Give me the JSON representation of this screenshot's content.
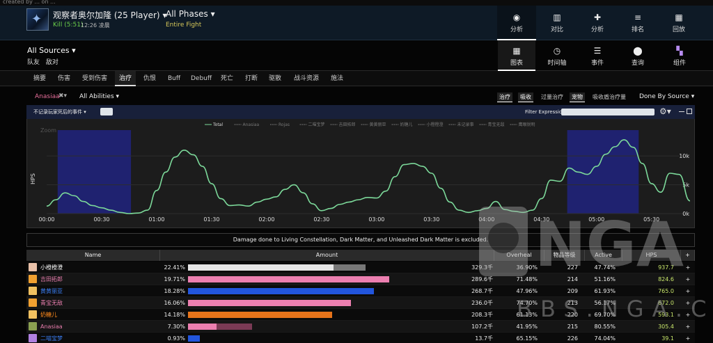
{
  "topstrip": {
    "text": "created by ... on ..."
  },
  "fight": {
    "boss_name": "观察者奥尔加隆 (25 Player)",
    "kill": "Kill (5:51)",
    "kill_time": "12:26 凌晨",
    "phases": "All Phases",
    "entire": "Entire Fight"
  },
  "topnav": [
    {
      "label": "分析",
      "icon": "eye-icon",
      "glyph": "◉"
    },
    {
      "label": "对比",
      "icon": "compare-icon",
      "glyph": "▥"
    },
    {
      "label": "分析",
      "icon": "puzzle-icon",
      "glyph": "✚"
    },
    {
      "label": "排名",
      "icon": "rank-icon",
      "glyph": "≡"
    },
    {
      "label": "回放",
      "icon": "replay-icon",
      "glyph": "▦"
    }
  ],
  "sources": {
    "label": "All Sources",
    "team": "队友",
    "enemy": "敌对"
  },
  "viewnav": [
    {
      "label": "图表",
      "icon": "table-icon",
      "glyph": "▦"
    },
    {
      "label": "时间轴",
      "icon": "clock-icon",
      "glyph": "◷"
    },
    {
      "label": "事件",
      "icon": "list-icon",
      "glyph": "☰"
    },
    {
      "label": "查询",
      "icon": "location-icon",
      "glyph": "⬤"
    },
    {
      "label": "组件",
      "icon": "widgets-icon",
      "glyph": "▚"
    }
  ],
  "tabs": [
    "摘要",
    "伤害",
    "受到伤害",
    "治疗",
    "仇恨",
    "Buff",
    "Debuff",
    "死亡",
    "打断",
    "驱散",
    "战斗资源",
    "施法"
  ],
  "active_tab": "治疗",
  "filters": {
    "player": "Anasiaa",
    "abilities": "All Abilities",
    "toggles": [
      "治疗",
      "吸收",
      "过量治疗",
      "宠物",
      "吸收盾治疗量"
    ],
    "done_by": "Done By Source"
  },
  "graph": {
    "death_filter": "不记录玩家死后的事件",
    "filter_expression": "Filter Expression:",
    "zoom": "Zoom"
  },
  "chart_data": {
    "type": "line",
    "ylabel": "HPS",
    "legend": [
      "Total",
      "Anasiaa",
      "Rojas",
      "二喵宝梦",
      "吉田拓郎",
      "黄黄丽亚",
      "奶糖儿",
      "小橙橙澄",
      "未记录事",
      "青宝无敌",
      "鹰眼锐明"
    ],
    "x_ticks": [
      "00:00",
      "00:30",
      "01:00",
      "01:30",
      "02:00",
      "02:30",
      "03:00",
      "03:30",
      "04:00",
      "04:30",
      "05:00",
      "05:30"
    ],
    "y_ticks": [
      "0k",
      "5k",
      "10k"
    ],
    "ylim": [
      0,
      14000
    ],
    "xlim": [
      0,
      351
    ],
    "highlight_ranges": [
      [
        6,
        46
      ],
      [
        284,
        323
      ]
    ],
    "series": [
      {
        "name": "Total",
        "color": "#7cd99a",
        "x": [
          0,
          5,
          10,
          15,
          20,
          25,
          30,
          35,
          40,
          45,
          50,
          55,
          60,
          65,
          70,
          75,
          80,
          85,
          90,
          95,
          100,
          105,
          110,
          115,
          120,
          125,
          130,
          135,
          140,
          145,
          150,
          155,
          160,
          165,
          170,
          175,
          180,
          185,
          190,
          195,
          200,
          205,
          210,
          215,
          220,
          225,
          230,
          235,
          240,
          245,
          250,
          255,
          260,
          265,
          270,
          275,
          280,
          285,
          290,
          295,
          300,
          305,
          310,
          315,
          320,
          325,
          330,
          335,
          340,
          345,
          351
        ],
        "values": [
          1300,
          2400,
          3600,
          3100,
          2100,
          1400,
          1000,
          600,
          200,
          0,
          100,
          600,
          4000,
          7200,
          9800,
          11000,
          10200,
          8200,
          5200,
          2600,
          1400,
          1500,
          1300,
          2000,
          2500,
          2900,
          4200,
          5000,
          3600,
          1700,
          500,
          900,
          1600,
          2000,
          2400,
          2800,
          2700,
          3900,
          6400,
          8500,
          8700,
          8200,
          7000,
          4400,
          2000,
          600,
          200,
          500,
          900,
          2100,
          700,
          400,
          200,
          600,
          2600,
          5800,
          5600,
          7900,
          7200,
          6800,
          8200,
          10300,
          11600,
          12800,
          11500,
          8700,
          5200,
          3700,
          7000,
          6800,
          2200
        ]
      }
    ]
  },
  "notice": "Damage done to Living Constellation, Dark Matter, and Unleashed Dark Matter is excluded.",
  "table": {
    "headers": [
      "Name",
      "Amount",
      "Overheal",
      "物品等级",
      "Active",
      "HPS",
      "+"
    ],
    "rows": [
      {
        "name": "小橙橙澄",
        "name_color": "#ffffff",
        "avatar_color": "#e8c0a8",
        "pct": "22.41%",
        "fill": 0.524,
        "over": 0.64,
        "bar_color": "#e5e5e5",
        "over_color": "#777777",
        "amount": "329.3千",
        "overheal": "36.90%",
        "ilvl": "227",
        "active": "47.74%",
        "hps": "937.7",
        "plus": "+"
      },
      {
        "name": "吉田拓郎",
        "name_color": "#ec7fb0",
        "avatar_color": "#f0a030",
        "pct": "19.71%",
        "fill": 0.725,
        "over": 0,
        "bar_color": "#ec7fb0",
        "over_color": "#ec7fb0",
        "amount": "289.6千",
        "overheal": "71.48%",
        "ilvl": "214",
        "active": "51.16%",
        "hps": "824.6",
        "plus": "+"
      },
      {
        "name": "黄黄丽亚",
        "name_color": "#3a7cf0",
        "avatar_color": "#f0c060",
        "pct": "18.28%",
        "fill": 0.672,
        "over": 0,
        "bar_color": "#2255dd",
        "over_color": "#2255dd",
        "amount": "268.7千",
        "overheal": "47.96%",
        "ilvl": "209",
        "active": "61.93%",
        "hps": "765.0",
        "plus": "+"
      },
      {
        "name": "青宝无敌",
        "name_color": "#ec7fb0",
        "avatar_color": "#f0a030",
        "pct": "16.06%",
        "fill": 0.589,
        "over": 0,
        "bar_color": "#ec7fb0",
        "over_color": "#ec7fb0",
        "amount": "236.0千",
        "overheal": "74.70%",
        "ilvl": "213",
        "active": "56.17%",
        "hps": "672.0",
        "plus": "+"
      },
      {
        "name": "奶糖儿",
        "name_color": "#ff8a1c",
        "avatar_color": "#f0c060",
        "pct": "14.18%",
        "fill": 0.521,
        "over": 0,
        "bar_color": "#e6731a",
        "over_color": "#e6731a",
        "amount": "208.3千",
        "overheal": "61.13%",
        "ilvl": "220",
        "active": "69.70%",
        "hps": "593.1",
        "plus": "+"
      },
      {
        "name": "Anasiaa",
        "name_color": "#ec7fb0",
        "avatar_color": "#8aa050",
        "pct": "7.30%",
        "fill": 0.103,
        "over": 0.23,
        "bar_color": "#ec7fb0",
        "over_color": "#7a3a55",
        "amount": "107.2千",
        "overheal": "41.95%",
        "ilvl": "215",
        "active": "80.55%",
        "hps": "305.4",
        "plus": "+"
      },
      {
        "name": "二喵宝梦",
        "name_color": "#3a7cf0",
        "avatar_color": "#b080e0",
        "pct": "0.93%",
        "fill": 0.043,
        "over": 0,
        "bar_color": "#2255dd",
        "over_color": "#2255dd",
        "amount": "13.7千",
        "overheal": "65.15%",
        "ilvl": "226",
        "active": "74.04%",
        "hps": "39.1",
        "plus": "+"
      }
    ]
  },
  "watermark": {
    "logo": "NGA",
    "url": "BBS.NGA.CN"
  }
}
